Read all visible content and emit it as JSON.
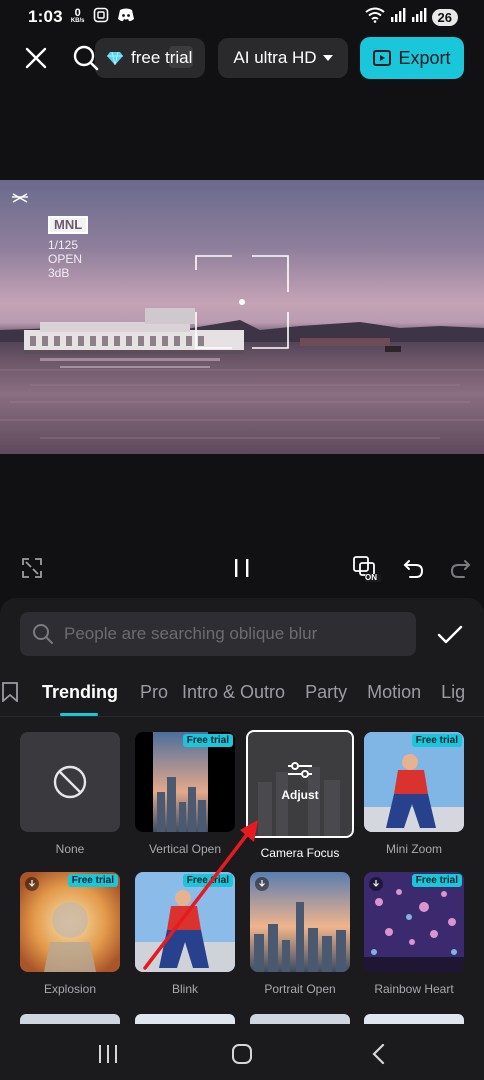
{
  "status_bar": {
    "time": "1:03",
    "net_speed_value": "0",
    "net_speed_unit": "KB/s",
    "battery": "26"
  },
  "top_bar": {
    "free_trial_label": "free trial",
    "resolution_label": "AI ultra HD",
    "export_label": "Export"
  },
  "preview": {
    "overlay": {
      "badge": "MNL",
      "line1": "1/125",
      "line2": "OPEN",
      "line3": "3dB"
    }
  },
  "controls": {
    "on_badge": "ON"
  },
  "sheet": {
    "search_placeholder": "People are searching oblique blur",
    "tabs": [
      "Trending",
      "Pro",
      "Intro & Outro",
      "Party",
      "Motion",
      "Lig"
    ],
    "active_tab": "Trending",
    "effects": [
      {
        "label": "None",
        "badge": ""
      },
      {
        "label": "Vertical Open",
        "badge": "Free trial"
      },
      {
        "label": "Camera Focus",
        "badge": "",
        "adjust_label": "Adjust",
        "selected": true
      },
      {
        "label": "Mini Zoom",
        "badge": "Free trial"
      },
      {
        "label": "Explosion",
        "badge": "Free trial"
      },
      {
        "label": "Blink",
        "badge": "Free trial"
      },
      {
        "label": "Portrait Open",
        "badge": ""
      },
      {
        "label": "Rainbow Heart",
        "badge": "Free trial"
      }
    ]
  },
  "colors": {
    "accent": "#19c6da",
    "background": "#111113",
    "sheet": "#1b1b1e",
    "annotation_arrow": "#e8191f"
  }
}
